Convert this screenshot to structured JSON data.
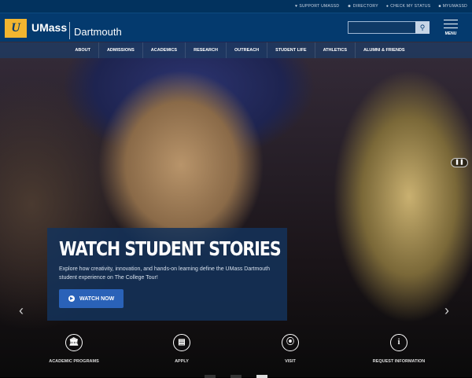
{
  "utility_links": [
    {
      "icon": "heart-icon",
      "glyph": "♥",
      "label": "SUPPORT UMASSD"
    },
    {
      "icon": "people-icon",
      "glyph": "☻",
      "label": "DIRECTORY"
    },
    {
      "icon": "check-circle-icon",
      "glyph": "●",
      "label": "CHECK MY STATUS"
    },
    {
      "icon": "lock-icon",
      "glyph": "■",
      "label": "MYUMASSD"
    }
  ],
  "brand": {
    "logo_glyph": "U",
    "name1": "UMass",
    "name2": "Dartmouth"
  },
  "search": {
    "placeholder": "",
    "icon": "⚲"
  },
  "menu_label": "MENU",
  "nav": [
    "ABOUT",
    "ADMISSIONS",
    "ACADEMICS",
    "RESEARCH",
    "OUTREACH",
    "STUDENT LIFE",
    "ATHLETICS",
    "ALUMNI & FRIENDS"
  ],
  "hero": {
    "title": "WATCH STUDENT STORIES",
    "text": "Explore how creativity, innovation, and hands-on learning define the UMass Dartmouth student experience on The College Tour!",
    "button": "WATCH NOW",
    "pause": "❚❚",
    "prev": "‹",
    "next": "›"
  },
  "quick_links": [
    {
      "icon": "bank-icon",
      "glyph": "🏛",
      "label": "ACADEMIC PROGRAMS"
    },
    {
      "icon": "document-icon",
      "glyph": "▤",
      "label": "APPLY"
    },
    {
      "icon": "map-pin-icon",
      "glyph": "⦿",
      "label": "VISIT"
    },
    {
      "icon": "info-icon",
      "glyph": "i",
      "label": "REQUEST INFORMATION"
    }
  ],
  "slides": {
    "count": 3,
    "active": 3
  }
}
